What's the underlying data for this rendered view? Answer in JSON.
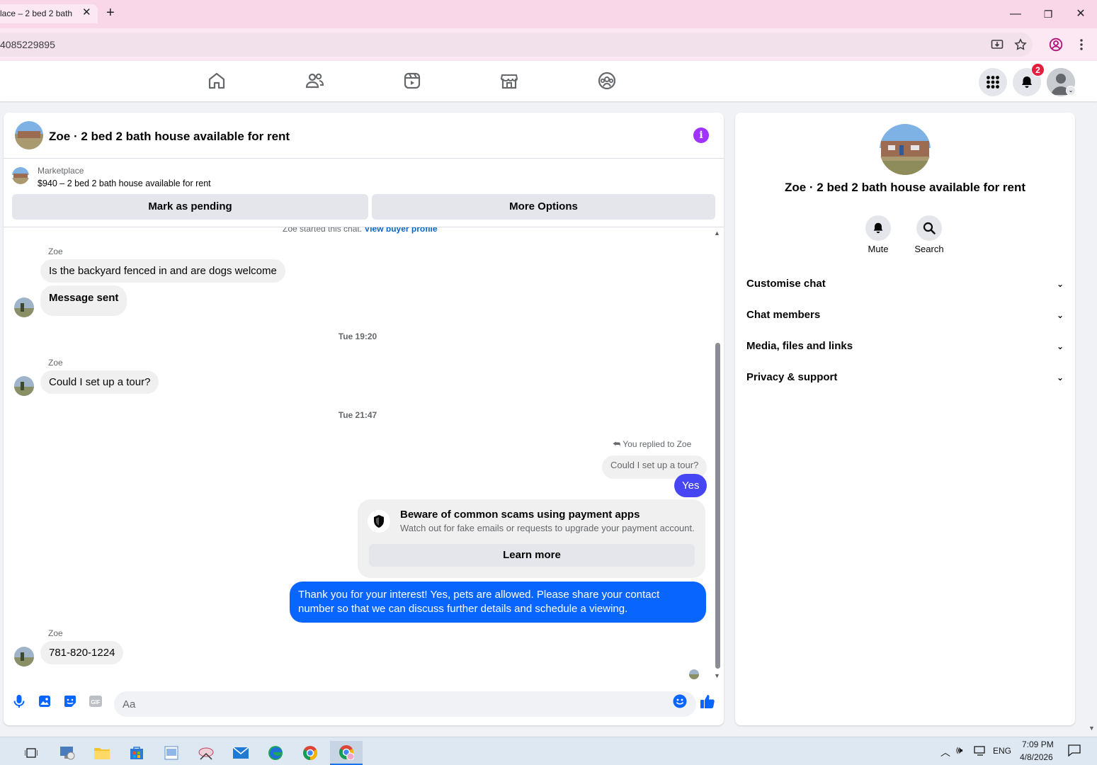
{
  "browser": {
    "tab_title": "lace – 2 bed 2 bath",
    "url": "4085229895",
    "minimize": "—",
    "maximize": "❐",
    "close": "✕"
  },
  "nav": {
    "notification_count": "2"
  },
  "chat": {
    "title": "Zoe · 2 bed 2 bath house available for rent",
    "marketplace_label": "Marketplace",
    "listing": "$940 – 2 bed 2 bath house available for rent",
    "mark_pending": "Mark as pending",
    "more_options": "More Options",
    "started_text": "Zoe started this chat.",
    "view_buyer": "View buyer profile",
    "messages": [
      {
        "sender": "Zoe",
        "text": "Is the backyard fenced in and are dogs welcome"
      },
      {
        "text": "Message sent"
      }
    ],
    "time1": "Tue 19:20",
    "msg2_sender": "Zoe",
    "msg2": "Could I set up a tour?",
    "time2": "Tue 21:47",
    "replied_label": "You replied to Zoe",
    "quoted": "Could I set up a tour?",
    "yes": "Yes",
    "scam_title": "Beware of common scams using payment apps",
    "scam_text": "Watch out for fake emails or requests to upgrade your payment account.",
    "learn_more": "Learn more",
    "long_reply": "Thank you for your interest! Yes, pets are allowed. Please share your contact number so that we can discuss further details and schedule a viewing.",
    "msg3_sender": "Zoe",
    "msg3": "781-820-1224",
    "input_placeholder": "Aa"
  },
  "side": {
    "name": "Zoe · 2 bed 2 bath house available for rent",
    "mute": "Mute",
    "search": "Search",
    "rows": [
      "Customise chat",
      "Chat members",
      "Media, files and links",
      "Privacy & support"
    ]
  },
  "taskbar": {
    "lang": "ENG",
    "time": "7:09 PM",
    "date": "4/8/2026"
  },
  "colors": {
    "accent": "#0866ff",
    "info": "#a033ff",
    "badge": "#e41e3f"
  }
}
